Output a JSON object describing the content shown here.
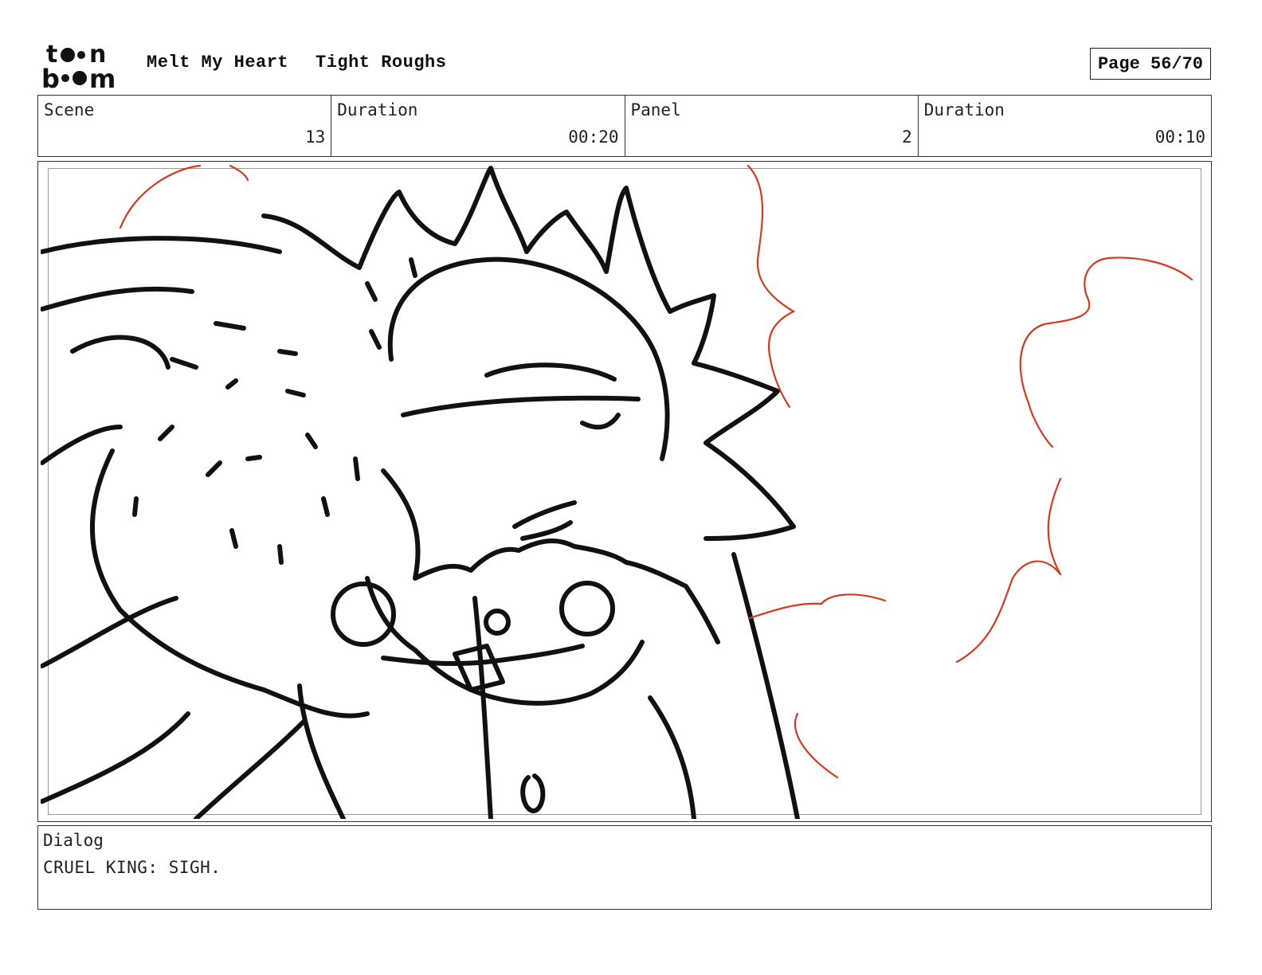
{
  "header": {
    "logo_text": "toon boom",
    "project_title": "Melt My Heart",
    "sequence_title": "Tight Roughs",
    "page_label": "Page 56/70"
  },
  "info": {
    "scene_label": "Scene",
    "scene_value": "13",
    "scene_duration_label": "Duration",
    "scene_duration_value": "00:20",
    "panel_label": "Panel",
    "panel_value": "2",
    "panel_duration_label": "Duration",
    "panel_duration_value": "00:10"
  },
  "panel": {
    "line_color": "#111111",
    "effect_color": "#d9381e"
  },
  "dialog": {
    "label": "Dialog",
    "text": "CRUEL KING: SIGH."
  }
}
